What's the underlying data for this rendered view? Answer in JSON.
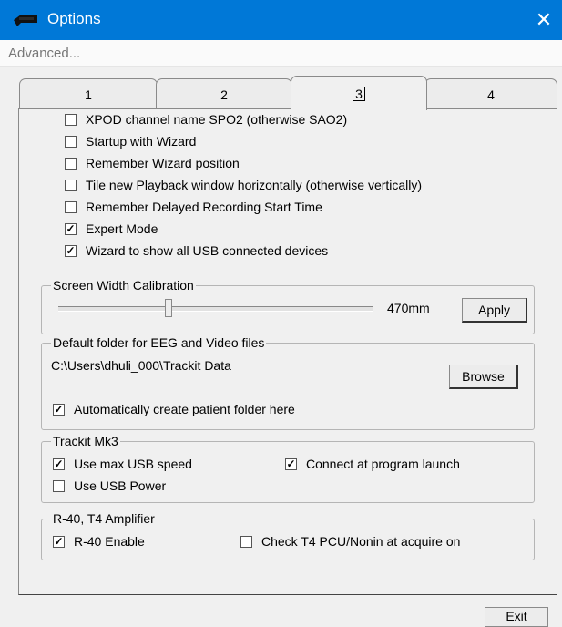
{
  "window": {
    "title": "Options",
    "close_glyph": "✕",
    "icon": "app-logo-icon"
  },
  "menu": {
    "advanced": "Advanced..."
  },
  "tabs": [
    {
      "label": "1",
      "active": false
    },
    {
      "label": "2",
      "active": false
    },
    {
      "label": "3",
      "active": true
    },
    {
      "label": "4",
      "active": false
    }
  ],
  "general_options": [
    {
      "label": "XPOD channel name SPO2 (otherwise SAO2)",
      "checked": false
    },
    {
      "label": "Startup with Wizard",
      "checked": false
    },
    {
      "label": "Remember Wizard position",
      "checked": false
    },
    {
      "label": "Tile new Playback window horizontally (otherwise vertically)",
      "checked": false
    },
    {
      "label": "Remember Delayed Recording Start Time",
      "checked": false
    },
    {
      "label": "Expert Mode",
      "checked": true
    },
    {
      "label": "Wizard to show all USB connected devices",
      "checked": true
    }
  ],
  "screen_width": {
    "group_label": "Screen Width Calibration",
    "value_text": "470mm",
    "slider_fraction": 0.35,
    "apply_label": "Apply"
  },
  "default_folder": {
    "group_label": "Default folder for EEG and Video files",
    "path": "C:\\Users\\dhuli_000\\Trackit Data",
    "browse_label": "Browse",
    "auto_create": {
      "label": "Automatically create patient folder here",
      "checked": true
    }
  },
  "trackit": {
    "group_label": "Trackit Mk3",
    "use_max_usb": {
      "label": "Use max USB speed",
      "checked": true
    },
    "connect_launch": {
      "label": "Connect at program launch",
      "checked": true
    },
    "use_usb_power": {
      "label": "Use USB Power",
      "checked": false
    }
  },
  "amplifier": {
    "group_label": "R-40, T4 Amplifier",
    "r40_enable": {
      "label": "R-40 Enable",
      "checked": true
    },
    "check_t4": {
      "label": "Check T4 PCU/Nonin at acquire on",
      "checked": false
    }
  },
  "footer": {
    "exit_label": "Exit"
  },
  "colors": {
    "titlebar": "#0078d7",
    "background": "#f0f0f0",
    "menu_text": "#777777"
  }
}
